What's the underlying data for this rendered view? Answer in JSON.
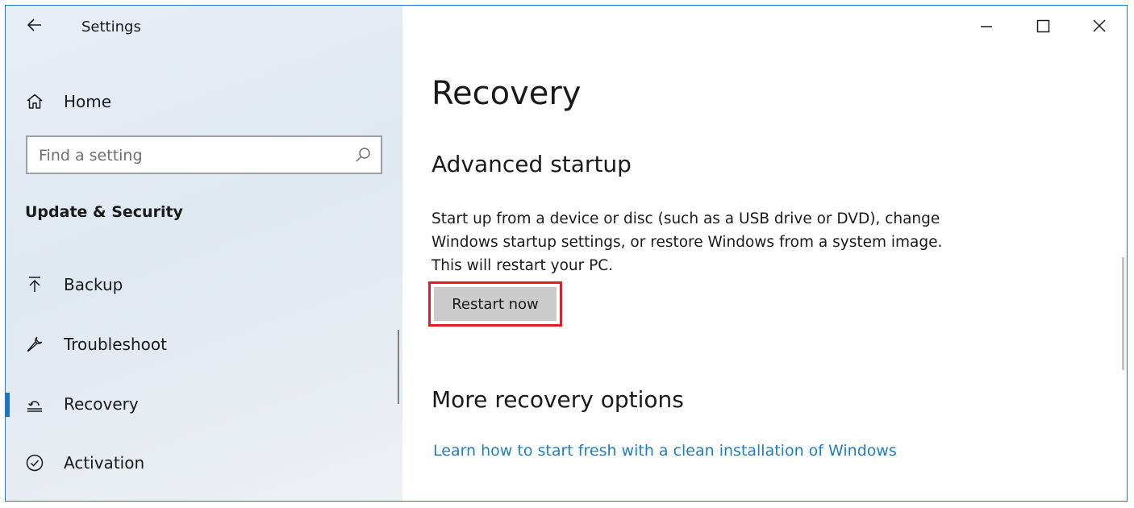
{
  "window": {
    "app_title": "Settings",
    "controls": {
      "minimize_icon": "minimize-icon",
      "maximize_icon": "maximize-icon",
      "close_icon": "close-icon"
    }
  },
  "sidebar": {
    "home_label": "Home",
    "search": {
      "placeholder": "Find a setting",
      "value": ""
    },
    "section_header": "Update & Security",
    "items": [
      {
        "label": "Backup",
        "icon": "upload-arrow-icon",
        "selected": false
      },
      {
        "label": "Troubleshoot",
        "icon": "wrench-icon",
        "selected": false
      },
      {
        "label": "Recovery",
        "icon": "recovery-icon",
        "selected": true
      },
      {
        "label": "Activation",
        "icon": "check-circle-icon",
        "selected": false
      }
    ]
  },
  "main": {
    "page_title": "Recovery",
    "advanced_startup": {
      "heading": "Advanced startup",
      "description_lines": [
        "Start up from a device or disc (such as a USB drive or DVD), change",
        "Windows startup settings, or restore Windows from a system image.",
        "This will restart your PC."
      ],
      "button_label": "Restart now"
    },
    "more_options": {
      "heading": "More recovery options",
      "link_text": "Learn how to start fresh with a clean installation of Windows"
    }
  },
  "colors": {
    "accent": "#1a73c7",
    "highlight_border": "#e01e2a",
    "link": "#1f7ec4",
    "button_bg": "#cccccc",
    "window_border": "#1e78d7"
  }
}
